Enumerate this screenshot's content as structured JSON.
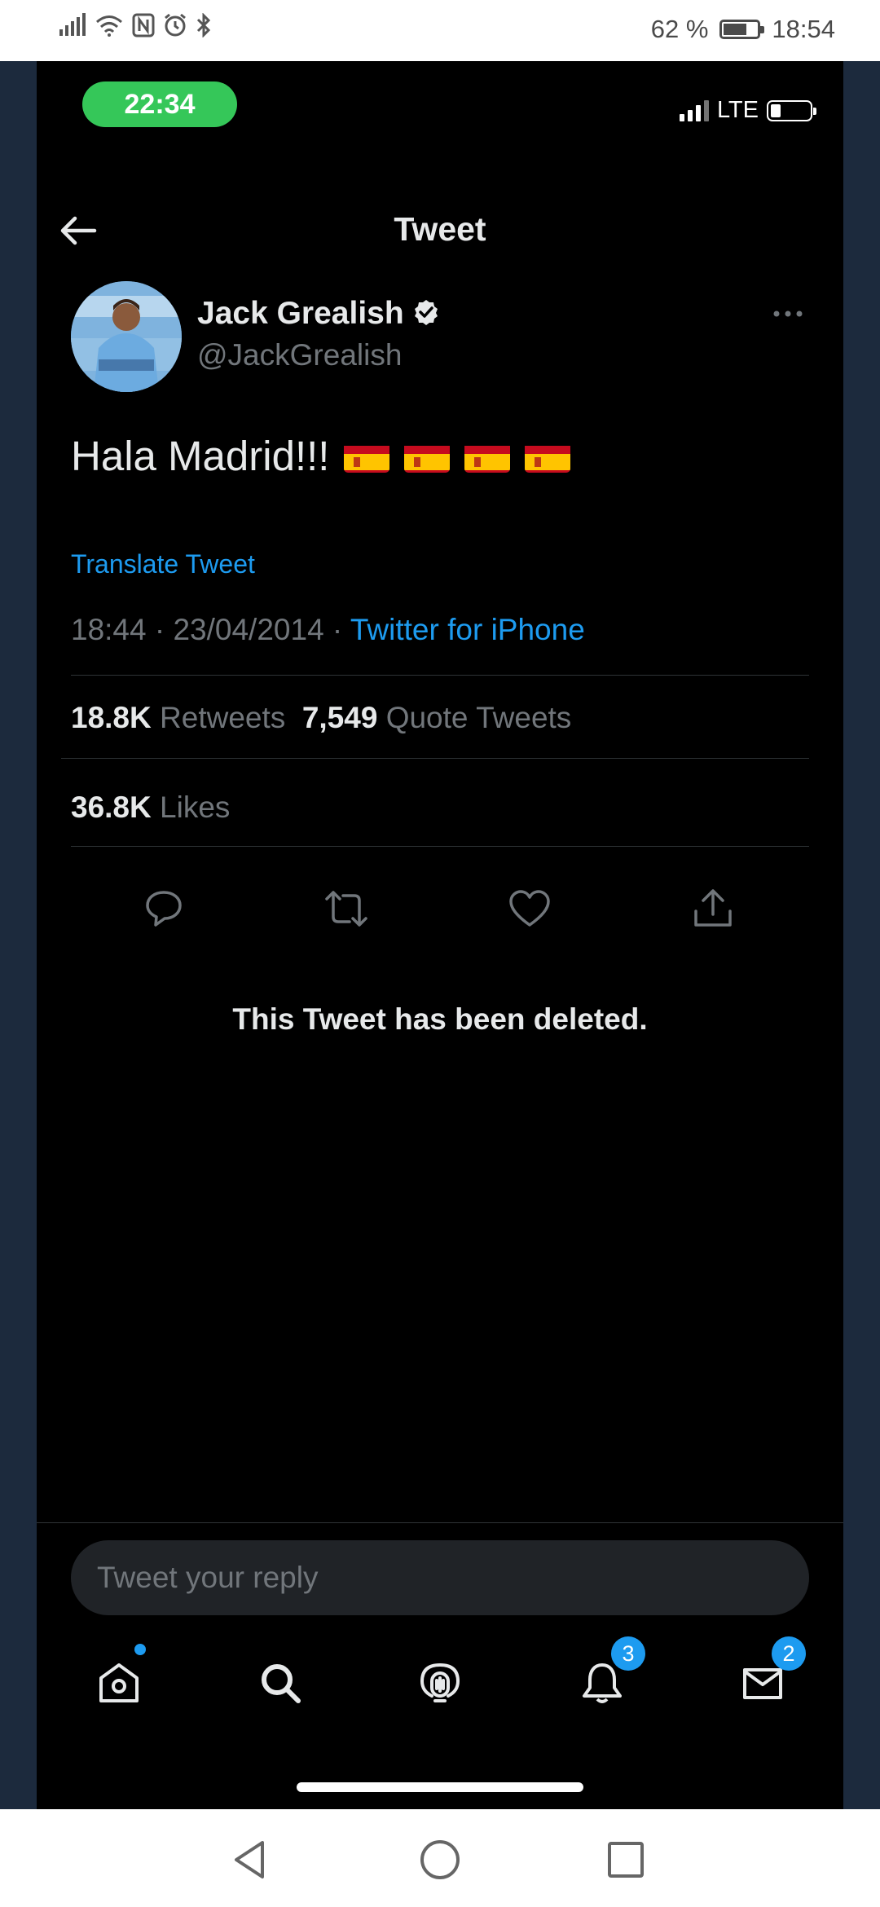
{
  "android_status": {
    "battery_percent": "62 %",
    "battery_level": 0.62,
    "time": "18:54",
    "icons": [
      "signal-icon",
      "wifi-icon",
      "nfc-icon",
      "alarm-icon",
      "bluetooth-icon"
    ]
  },
  "ios_status": {
    "time": "22:34",
    "network": "LTE",
    "battery_level": 0.2
  },
  "header": {
    "title": "Tweet",
    "back_icon": "back-arrow-icon"
  },
  "tweet": {
    "author_name": "Jack Grealish",
    "author_handle": "@JackGrealish",
    "verified": true,
    "text": "Hala Madrid!!!",
    "emoji": [
      "flag-spain",
      "flag-spain",
      "flag-spain",
      "flag-spain"
    ],
    "translate_label": "Translate Tweet",
    "timestamp": "18:44 · 23/04/2014 · ",
    "source": "Twitter for iPhone",
    "retweets_count": "18.8K",
    "retweets_label": "Retweets",
    "quotes_count": "7,549",
    "quotes_label": "Quote Tweets",
    "likes_count": "36.8K",
    "likes_label": "Likes",
    "deleted_notice": "This Tweet has been deleted."
  },
  "reply": {
    "placeholder": "Tweet your reply"
  },
  "tabbar": {
    "items": [
      {
        "name": "home",
        "icon": "home-icon",
        "dot": true
      },
      {
        "name": "search",
        "icon": "search-icon"
      },
      {
        "name": "spaces",
        "icon": "spaces-icon"
      },
      {
        "name": "notifications",
        "icon": "bell-icon",
        "badge": "3"
      },
      {
        "name": "messages",
        "icon": "mail-icon",
        "badge": "2"
      }
    ]
  },
  "colors": {
    "background": "#000000",
    "accent": "#1d9bf0",
    "text": "#e7e9ea",
    "muted": "#71767b",
    "side_panel": "#1c2a3d",
    "time_pill": "#35c759"
  }
}
